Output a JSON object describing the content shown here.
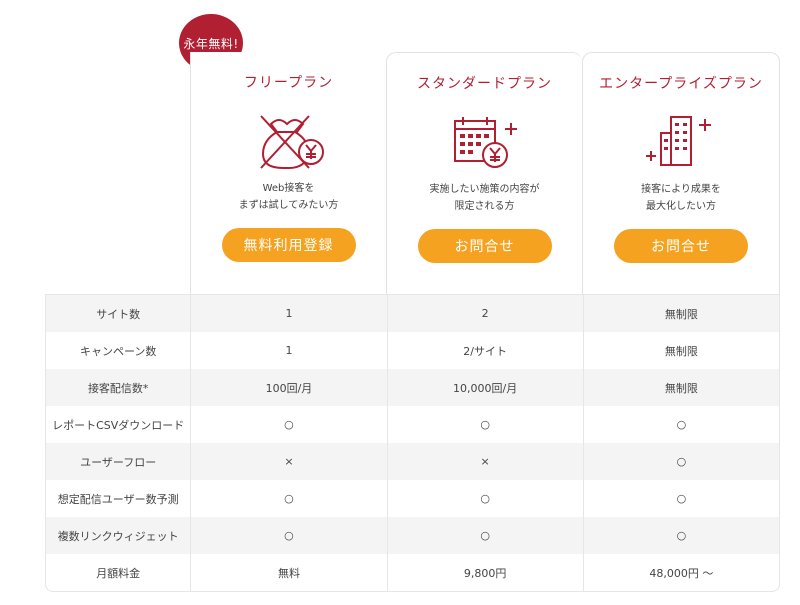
{
  "badge": "永年無料!",
  "plans": [
    {
      "title": "フリープラン",
      "desc_line1": "Web接客を",
      "desc_line2": "まずは試してみたい方",
      "button": "無料利用登録",
      "icon": "free-yen-icon"
    },
    {
      "title": "スタンダードプラン",
      "desc_line1": "実施したい施策の内容が",
      "desc_line2": "限定される方",
      "button": "お問合せ",
      "icon": "calendar-yen-icon"
    },
    {
      "title": "エンタープライズプラン",
      "desc_line1": "接客により成果を",
      "desc_line2": "最大化したい方",
      "button": "お問合せ",
      "icon": "buildings-icon"
    }
  ],
  "rows": [
    {
      "label": "サイト数",
      "values": [
        "1",
        "2",
        "無制限"
      ]
    },
    {
      "label": "キャンペーン数",
      "values": [
        "1",
        "2/サイト",
        "無制限"
      ]
    },
    {
      "label": "接客配信数*",
      "values": [
        "100回/月",
        "10,000回/月",
        "無制限"
      ]
    },
    {
      "label": "レポートCSVダウンロード",
      "values": [
        "○",
        "○",
        "○"
      ]
    },
    {
      "label": "ユーザーフロー",
      "values": [
        "×",
        "×",
        "○"
      ]
    },
    {
      "label": "想定配信ユーザー数予測",
      "values": [
        "○",
        "○",
        "○"
      ]
    },
    {
      "label": "複数リンクウィジェット",
      "values": [
        "○",
        "○",
        "○"
      ]
    },
    {
      "label": "月額料金",
      "values": [
        "無料",
        "9,800円",
        "48,000円 ～"
      ]
    }
  ],
  "colors": {
    "brand": "#b11f33",
    "button": "#f4a21f",
    "row_alt": "#f4f4f4"
  }
}
